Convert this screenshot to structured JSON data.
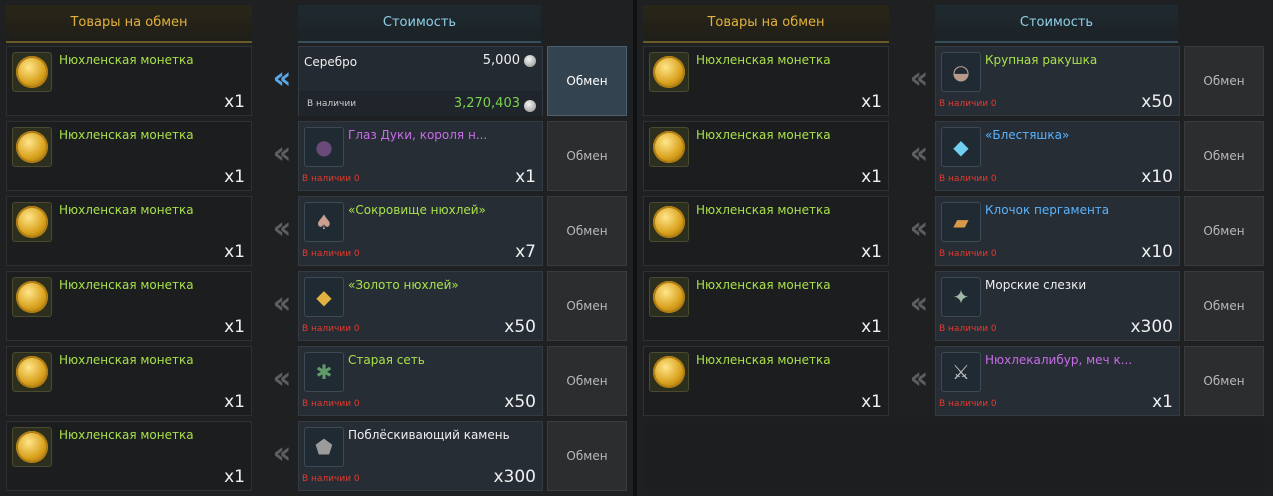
{
  "header": {
    "goods": "Товары на обмен",
    "cost": "Стоимость"
  },
  "colors": {
    "green_name": "#a8e14a",
    "purple_name": "#c86ce8",
    "blue_name": "#5ab4ff",
    "white_name": "#eeeeee",
    "red": "#e23a2e"
  },
  "left": [
    {
      "item": "Нюхленская монетка",
      "qty": "x1",
      "cost_type": "silver",
      "silver_label": "Серебро",
      "silver_value": "5,000",
      "silver_avail_label": "В наличии",
      "silver_avail_value": "3,270,403",
      "button": "Обмен",
      "active": true
    },
    {
      "item": "Нюхленская монетка",
      "qty": "x1",
      "cost_name": "Глаз Дуки, короля н...",
      "cost_color": "purple",
      "cost_icon": "purple-orb-icon",
      "avail": "В наличии 0",
      "cost_qty": "x1",
      "button": "Обмен"
    },
    {
      "item": "Нюхленская монетка",
      "qty": "x1",
      "cost_name": "«Сокровище нюхлей»",
      "cost_color": "green",
      "cost_icon": "mushroom-icon",
      "avail": "В наличии 0",
      "cost_qty": "x7",
      "button": "Обмен"
    },
    {
      "item": "Нюхленская монетка",
      "qty": "x1",
      "cost_name": "«Золото нюхлей»",
      "cost_color": "green",
      "cost_icon": "gold-nugget-icon",
      "avail": "В наличии 0",
      "cost_qty": "x50",
      "button": "Обмен"
    },
    {
      "item": "Нюхленская монетка",
      "qty": "x1",
      "cost_name": "Старая сеть",
      "cost_color": "green",
      "cost_icon": "net-icon",
      "avail": "В наличии 0",
      "cost_qty": "x50",
      "button": "Обмен"
    },
    {
      "item": "Нюхленская монетка",
      "qty": "x1",
      "cost_name": "Поблёскивающий камень",
      "cost_color": "white",
      "cost_icon": "stone-icon",
      "avail": "В наличии 0",
      "cost_qty": "x300",
      "button": "Обмен"
    }
  ],
  "right": [
    {
      "item": "Нюхленская монетка",
      "qty": "x1",
      "cost_name": "Крупная ракушка",
      "cost_color": "green",
      "cost_icon": "shell-icon",
      "avail": "В наличии 0",
      "cost_qty": "x50",
      "button": "Обмен"
    },
    {
      "item": "Нюхленская монетка",
      "qty": "x1",
      "cost_name": "«Блестяшка»",
      "cost_color": "blue",
      "cost_icon": "crystal-icon",
      "avail": "В наличии 0",
      "cost_qty": "x10",
      "button": "Обмен"
    },
    {
      "item": "Нюхленская монетка",
      "qty": "x1",
      "cost_name": "Клочок пергамента",
      "cost_color": "blue",
      "cost_icon": "parchment-icon",
      "avail": "В наличии 0",
      "cost_qty": "x10",
      "button": "Обмен"
    },
    {
      "item": "Нюхленская монетка",
      "qty": "x1",
      "cost_name": "Морские слезки",
      "cost_color": "white",
      "cost_icon": "sea-tears-icon",
      "avail": "В наличии 0",
      "cost_qty": "x300",
      "button": "Обмен"
    },
    {
      "item": "Нюхленская монетка",
      "qty": "x1",
      "cost_name": "Нюхлекалибур, меч к...",
      "cost_color": "purple",
      "cost_icon": "sword-icon",
      "avail": "В наличии 0",
      "cost_qty": "x1",
      "button": "Обмен"
    }
  ]
}
